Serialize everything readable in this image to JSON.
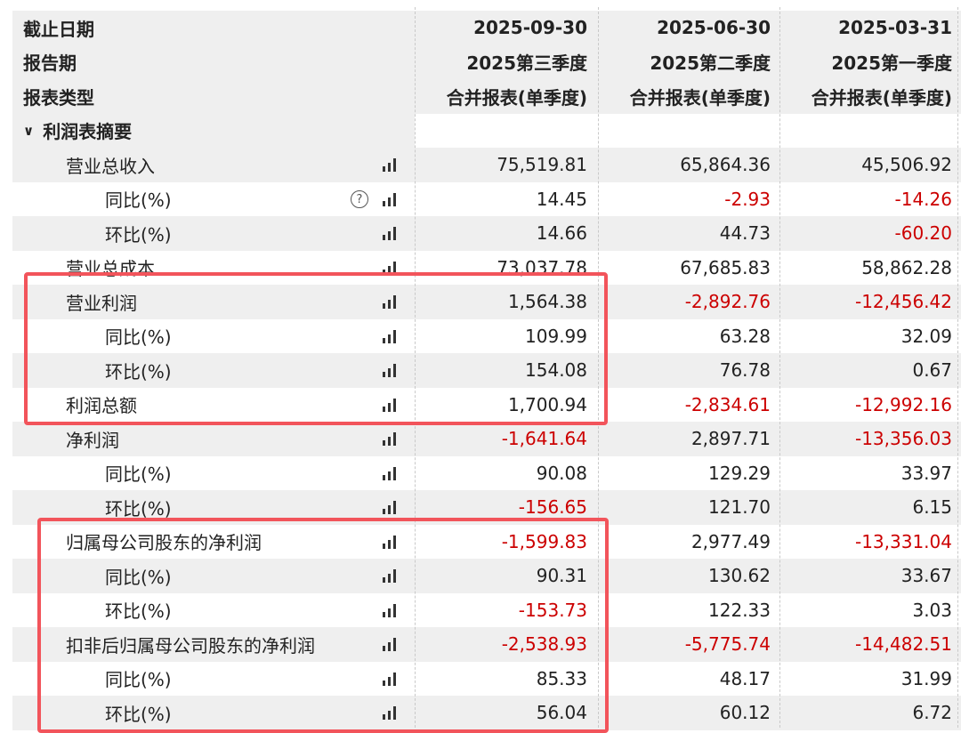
{
  "header": {
    "rows": [
      {
        "label": "截止日期",
        "cols": [
          "2025-09-30",
          "2025-06-30",
          "2025-03-31"
        ]
      },
      {
        "label": "报告期",
        "cols": [
          "2025第三季度",
          "2025第二季度",
          "2025第一季度"
        ]
      },
      {
        "label": "报表类型",
        "cols": [
          "合并报表(单季度)",
          "合并报表(单季度)",
          "合并报表(单季度)"
        ]
      }
    ]
  },
  "section": {
    "label": "利润表摘要",
    "chevron": "chevron-down-icon",
    "bg": "#efefef"
  },
  "rows": [
    {
      "label": "营业总收入",
      "level": 1,
      "help": false,
      "values": [
        "75,519.81",
        "65,864.36",
        "45,506.92"
      ],
      "neg": [
        false,
        false,
        false
      ]
    },
    {
      "label": "同比(%)",
      "level": 2,
      "help": true,
      "values": [
        "14.45",
        "-2.93",
        "-14.26"
      ],
      "neg": [
        false,
        true,
        true
      ]
    },
    {
      "label": "环比(%)",
      "level": 2,
      "help": false,
      "values": [
        "14.66",
        "44.73",
        "-60.20"
      ],
      "neg": [
        false,
        false,
        true
      ]
    },
    {
      "label": "营业总成本",
      "level": 1,
      "help": false,
      "values": [
        "73,037.78",
        "67,685.83",
        "58,862.28"
      ],
      "neg": [
        false,
        false,
        false
      ]
    },
    {
      "label": "营业利润",
      "level": 1,
      "help": false,
      "values": [
        "1,564.38",
        "-2,892.76",
        "-12,456.42"
      ],
      "neg": [
        false,
        true,
        true
      ]
    },
    {
      "label": "同比(%)",
      "level": 2,
      "help": false,
      "values": [
        "109.99",
        "63.28",
        "32.09"
      ],
      "neg": [
        false,
        false,
        false
      ]
    },
    {
      "label": "环比(%)",
      "level": 2,
      "help": false,
      "values": [
        "154.08",
        "76.78",
        "0.67"
      ],
      "neg": [
        false,
        false,
        false
      ]
    },
    {
      "label": "利润总额",
      "level": 1,
      "help": false,
      "values": [
        "1,700.94",
        "-2,834.61",
        "-12,992.16"
      ],
      "neg": [
        false,
        true,
        true
      ]
    },
    {
      "label": "净利润",
      "level": 1,
      "help": false,
      "values": [
        "-1,641.64",
        "2,897.71",
        "-13,356.03"
      ],
      "neg": [
        true,
        false,
        true
      ]
    },
    {
      "label": "同比(%)",
      "level": 2,
      "help": false,
      "values": [
        "90.08",
        "129.29",
        "33.97"
      ],
      "neg": [
        false,
        false,
        false
      ]
    },
    {
      "label": "环比(%)",
      "level": 2,
      "help": false,
      "values": [
        "-156.65",
        "121.70",
        "6.15"
      ],
      "neg": [
        true,
        false,
        false
      ]
    },
    {
      "label": "归属母公司股东的净利润",
      "level": 1,
      "help": false,
      "values": [
        "-1,599.83",
        "2,977.49",
        "-13,331.04"
      ],
      "neg": [
        true,
        false,
        true
      ]
    },
    {
      "label": "同比(%)",
      "level": 2,
      "help": false,
      "values": [
        "90.31",
        "130.62",
        "33.67"
      ],
      "neg": [
        false,
        false,
        false
      ]
    },
    {
      "label": "环比(%)",
      "level": 2,
      "help": false,
      "values": [
        "-153.73",
        "122.33",
        "3.03"
      ],
      "neg": [
        true,
        false,
        false
      ]
    },
    {
      "label": "扣非后归属母公司股东的净利润",
      "level": 1,
      "help": false,
      "values": [
        "-2,538.93",
        "-5,775.74",
        "-14,482.51"
      ],
      "neg": [
        true,
        true,
        true
      ]
    },
    {
      "label": "同比(%)",
      "level": 2,
      "help": false,
      "values": [
        "85.33",
        "48.17",
        "31.99"
      ],
      "neg": [
        false,
        false,
        false
      ]
    },
    {
      "label": "环比(%)",
      "level": 2,
      "help": false,
      "values": [
        "56.04",
        "60.12",
        "6.72"
      ],
      "neg": [
        false,
        false,
        false
      ]
    }
  ],
  "icons": {
    "chart": "bar-chart-icon",
    "help": "question-circle-icon"
  },
  "colors": {
    "negative": "#cc0000",
    "highlight_box": "#f2545b",
    "row_gray": "#efefef"
  }
}
